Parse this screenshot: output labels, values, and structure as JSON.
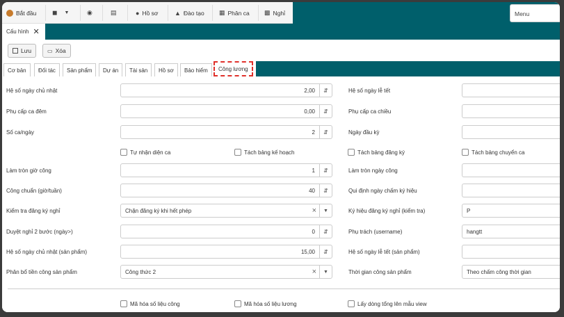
{
  "menu": {
    "start_label": "Bắt đầu",
    "items": [
      {
        "icon": "cube-icon",
        "label": ""
      },
      {
        "icon": "dashboard-icon",
        "label": ""
      },
      {
        "icon": "chart-icon",
        "label": ""
      },
      {
        "icon": "user-icon",
        "label": "Hồ sơ"
      },
      {
        "icon": "graduation-icon",
        "label": "Đào tạo"
      },
      {
        "icon": "calendar-icon",
        "label": "Phân ca"
      },
      {
        "icon": "card-icon",
        "label": "Nghỉ"
      }
    ],
    "right_label": "Menu"
  },
  "tab": {
    "label": "Cấu hình"
  },
  "toolbar": {
    "save_label": "Lưu",
    "delete_label": "Xóa"
  },
  "section_tabs": [
    "Cơ bản",
    "Đối tác",
    "Sản phẩm",
    "Dự án",
    "Tài sản",
    "Hồ sơ",
    "Bảo hiểm",
    "Công lương"
  ],
  "form": {
    "left": [
      {
        "label": "Hệ số ngày chủ nhật",
        "value": "2,00",
        "kind": "number"
      },
      {
        "label": "Phụ cấp ca đêm",
        "value": "0,00",
        "kind": "number"
      },
      {
        "label": "Số ca/ngày",
        "value": "2",
        "kind": "number"
      },
      {
        "label": "Làm tròn giờ công",
        "value": "1",
        "kind": "number"
      },
      {
        "label": "Công chuẩn (giờ/tuần)",
        "value": "40",
        "kind": "number"
      },
      {
        "label": "Kiểm tra đăng ký nghỉ",
        "value": "Chặn đăng ký khi hết phép",
        "kind": "select"
      },
      {
        "label": "Duyệt nghỉ 2 bước (ngày>)",
        "value": "0",
        "kind": "number"
      },
      {
        "label": "Hệ số ngày chủ nhật (sản phẩm)",
        "value": "15,00",
        "kind": "number"
      },
      {
        "label": "Phân bổ tiền công sản phẩm",
        "value": "Công thức 2",
        "kind": "select"
      }
    ],
    "right": [
      {
        "label": "Hệ số ngày lễ tết",
        "value": ""
      },
      {
        "label": "Phụ cấp ca chiều",
        "value": ""
      },
      {
        "label": "Ngày đầu kỳ",
        "value": ""
      },
      {
        "label": "Làm tròn ngày công",
        "value": ""
      },
      {
        "label": "Qui định ngày chấm ký hiệu",
        "value": ""
      },
      {
        "label": "Ký hiệu đăng ký nghỉ (kiểm tra)",
        "value": "P"
      },
      {
        "label": "Phụ trách (username)",
        "value": "hangtt"
      },
      {
        "label": "Hệ số ngày lễ tết (sản phẩm)",
        "value": ""
      },
      {
        "label": "Thời gian công sản phẩm",
        "value": "Theo chấm công thời gian"
      }
    ],
    "checks_row1": [
      "Tự nhận diện ca",
      "Tách bảng kế hoạch",
      "Tách bảng đăng ký",
      "Tách bảng chuyển ca"
    ],
    "checks_row2": [
      "Mã hóa số liệu công",
      "Mã hóa số liệu lương",
      "Lấy dòng tổng lên mẫu view"
    ]
  }
}
